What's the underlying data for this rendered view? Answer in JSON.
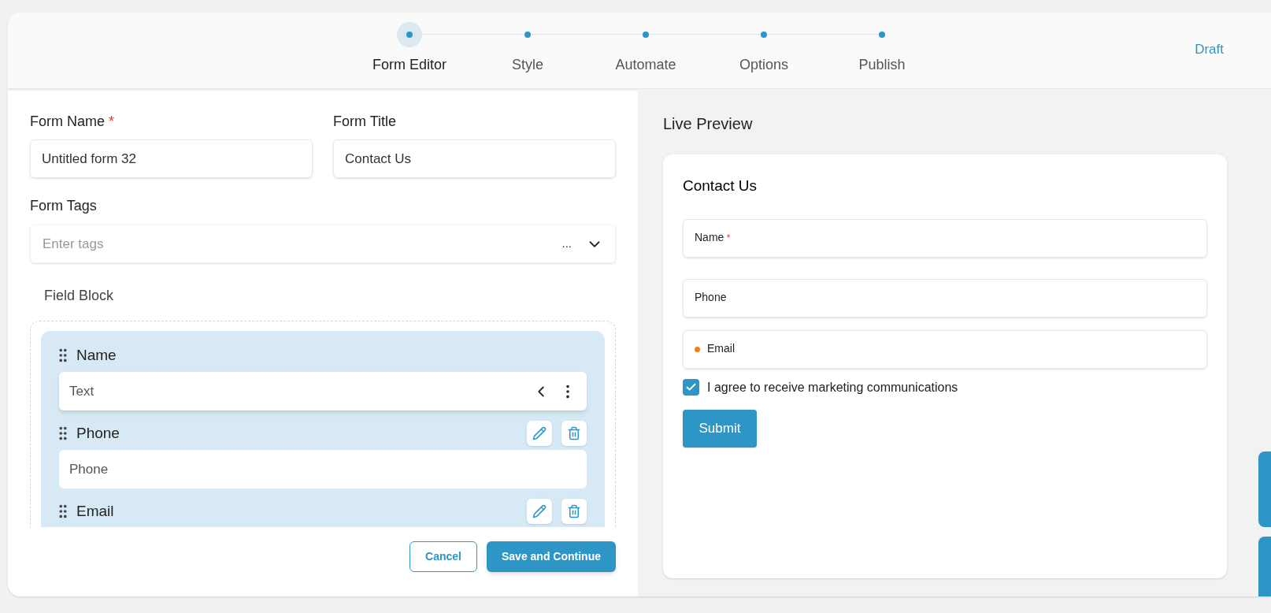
{
  "steps": [
    {
      "label": "Form Editor",
      "selected": true
    },
    {
      "label": "Style",
      "selected": false
    },
    {
      "label": "Automate",
      "selected": false
    },
    {
      "label": "Options",
      "selected": false
    },
    {
      "label": "Publish",
      "selected": false
    }
  ],
  "status": "Draft",
  "required_mark": "*",
  "editor": {
    "form_name": {
      "label": "Form Name",
      "required": true,
      "value": "Untitled form 32"
    },
    "form_title": {
      "label": "Form Title",
      "value": "Contact Us"
    },
    "form_tags": {
      "label": "Form Tags",
      "placeholder": "Enter tags",
      "more": "..."
    },
    "field_block": {
      "title": "Field Block",
      "fields": [
        {
          "label": "Name",
          "input": "Text",
          "active": true
        },
        {
          "label": "Phone",
          "input": "Phone",
          "active": false
        },
        {
          "label": "Email",
          "active": false
        }
      ]
    },
    "buttons": {
      "cancel": "Cancel",
      "save": "Save and Continue"
    }
  },
  "preview": {
    "title": "Live Preview",
    "form_title": "Contact Us",
    "fields": [
      {
        "label": "Name",
        "required": true,
        "flagged": false
      },
      {
        "label": "Phone",
        "required": false,
        "flagged": false
      },
      {
        "label": "Email",
        "required": false,
        "flagged": true
      }
    ],
    "consent": {
      "label": "I agree to receive marketing communications",
      "checked": true
    },
    "submit": "Submit"
  }
}
